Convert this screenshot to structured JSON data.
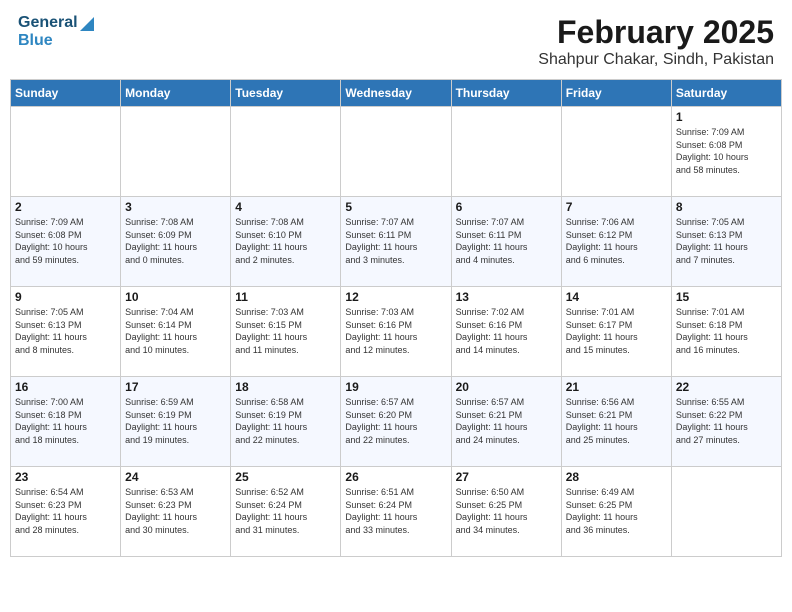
{
  "logo": {
    "general": "General",
    "blue": "Blue"
  },
  "header": {
    "month": "February 2025",
    "location": "Shahpur Chakar, Sindh, Pakistan"
  },
  "weekdays": [
    "Sunday",
    "Monday",
    "Tuesday",
    "Wednesday",
    "Thursday",
    "Friday",
    "Saturday"
  ],
  "weeks": [
    {
      "days": [
        {
          "num": "",
          "info": ""
        },
        {
          "num": "",
          "info": ""
        },
        {
          "num": "",
          "info": ""
        },
        {
          "num": "",
          "info": ""
        },
        {
          "num": "",
          "info": ""
        },
        {
          "num": "",
          "info": ""
        },
        {
          "num": "1",
          "info": "Sunrise: 7:09 AM\nSunset: 6:08 PM\nDaylight: 10 hours\nand 58 minutes."
        }
      ]
    },
    {
      "days": [
        {
          "num": "2",
          "info": "Sunrise: 7:09 AM\nSunset: 6:08 PM\nDaylight: 10 hours\nand 59 minutes."
        },
        {
          "num": "3",
          "info": "Sunrise: 7:08 AM\nSunset: 6:09 PM\nDaylight: 11 hours\nand 0 minutes."
        },
        {
          "num": "4",
          "info": "Sunrise: 7:08 AM\nSunset: 6:10 PM\nDaylight: 11 hours\nand 2 minutes."
        },
        {
          "num": "5",
          "info": "Sunrise: 7:07 AM\nSunset: 6:11 PM\nDaylight: 11 hours\nand 3 minutes."
        },
        {
          "num": "6",
          "info": "Sunrise: 7:07 AM\nSunset: 6:11 PM\nDaylight: 11 hours\nand 4 minutes."
        },
        {
          "num": "7",
          "info": "Sunrise: 7:06 AM\nSunset: 6:12 PM\nDaylight: 11 hours\nand 6 minutes."
        },
        {
          "num": "8",
          "info": "Sunrise: 7:05 AM\nSunset: 6:13 PM\nDaylight: 11 hours\nand 7 minutes."
        }
      ]
    },
    {
      "days": [
        {
          "num": "9",
          "info": "Sunrise: 7:05 AM\nSunset: 6:13 PM\nDaylight: 11 hours\nand 8 minutes."
        },
        {
          "num": "10",
          "info": "Sunrise: 7:04 AM\nSunset: 6:14 PM\nDaylight: 11 hours\nand 10 minutes."
        },
        {
          "num": "11",
          "info": "Sunrise: 7:03 AM\nSunset: 6:15 PM\nDaylight: 11 hours\nand 11 minutes."
        },
        {
          "num": "12",
          "info": "Sunrise: 7:03 AM\nSunset: 6:16 PM\nDaylight: 11 hours\nand 12 minutes."
        },
        {
          "num": "13",
          "info": "Sunrise: 7:02 AM\nSunset: 6:16 PM\nDaylight: 11 hours\nand 14 minutes."
        },
        {
          "num": "14",
          "info": "Sunrise: 7:01 AM\nSunset: 6:17 PM\nDaylight: 11 hours\nand 15 minutes."
        },
        {
          "num": "15",
          "info": "Sunrise: 7:01 AM\nSunset: 6:18 PM\nDaylight: 11 hours\nand 16 minutes."
        }
      ]
    },
    {
      "days": [
        {
          "num": "16",
          "info": "Sunrise: 7:00 AM\nSunset: 6:18 PM\nDaylight: 11 hours\nand 18 minutes."
        },
        {
          "num": "17",
          "info": "Sunrise: 6:59 AM\nSunset: 6:19 PM\nDaylight: 11 hours\nand 19 minutes."
        },
        {
          "num": "18",
          "info": "Sunrise: 6:58 AM\nSunset: 6:19 PM\nDaylight: 11 hours\nand 22 minutes."
        },
        {
          "num": "19",
          "info": "Sunrise: 6:57 AM\nSunset: 6:20 PM\nDaylight: 11 hours\nand 22 minutes."
        },
        {
          "num": "20",
          "info": "Sunrise: 6:57 AM\nSunset: 6:21 PM\nDaylight: 11 hours\nand 24 minutes."
        },
        {
          "num": "21",
          "info": "Sunrise: 6:56 AM\nSunset: 6:21 PM\nDaylight: 11 hours\nand 25 minutes."
        },
        {
          "num": "22",
          "info": "Sunrise: 6:55 AM\nSunset: 6:22 PM\nDaylight: 11 hours\nand 27 minutes."
        }
      ]
    },
    {
      "days": [
        {
          "num": "23",
          "info": "Sunrise: 6:54 AM\nSunset: 6:23 PM\nDaylight: 11 hours\nand 28 minutes."
        },
        {
          "num": "24",
          "info": "Sunrise: 6:53 AM\nSunset: 6:23 PM\nDaylight: 11 hours\nand 30 minutes."
        },
        {
          "num": "25",
          "info": "Sunrise: 6:52 AM\nSunset: 6:24 PM\nDaylight: 11 hours\nand 31 minutes."
        },
        {
          "num": "26",
          "info": "Sunrise: 6:51 AM\nSunset: 6:24 PM\nDaylight: 11 hours\nand 33 minutes."
        },
        {
          "num": "27",
          "info": "Sunrise: 6:50 AM\nSunset: 6:25 PM\nDaylight: 11 hours\nand 34 minutes."
        },
        {
          "num": "28",
          "info": "Sunrise: 6:49 AM\nSunset: 6:25 PM\nDaylight: 11 hours\nand 36 minutes."
        },
        {
          "num": "",
          "info": ""
        }
      ]
    }
  ]
}
